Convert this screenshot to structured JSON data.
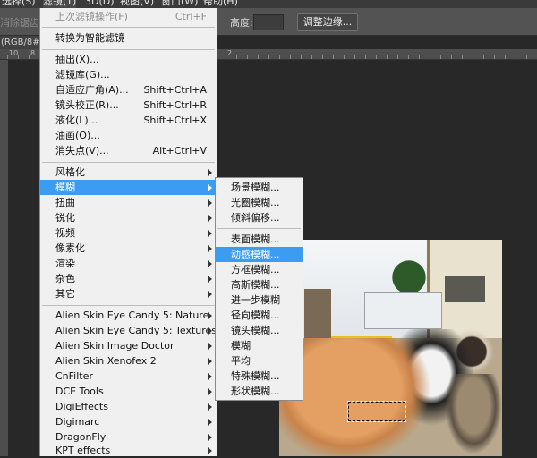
{
  "menubar": {
    "items": [
      {
        "label": "选择(S)",
        "active": false
      },
      {
        "label": "滤镜(T)",
        "active": true
      },
      {
        "label": "3D(D)",
        "active": false
      },
      {
        "label": "视图(V)",
        "active": false
      },
      {
        "label": "窗口(W)",
        "active": false
      },
      {
        "label": "帮助(H)",
        "active": false
      }
    ]
  },
  "options_bar": {
    "ghost_text": "消除锯齿",
    "height_label": "高度:",
    "refine_edge_button": "调整边缘..."
  },
  "document": {
    "tab_label": "(RGB/8#)",
    "ruler_numbers": [
      "10",
      "8",
      "2"
    ]
  },
  "filter_menu": {
    "items": [
      {
        "label": "上次滤镜操作(F)",
        "shortcut": "Ctrl+F",
        "disabled": true
      },
      {
        "label": "转换为智能滤镜"
      },
      {
        "label": "抽出(X)..."
      },
      {
        "label": "滤镜库(G)..."
      },
      {
        "label": "自适应广角(A)...",
        "shortcut": "Shift+Ctrl+A"
      },
      {
        "label": "镜头校正(R)...",
        "shortcut": "Shift+Ctrl+R"
      },
      {
        "label": "液化(L)...",
        "shortcut": "Shift+Ctrl+X"
      },
      {
        "label": "油画(O)..."
      },
      {
        "label": "消失点(V)...",
        "shortcut": "Alt+Ctrl+V"
      },
      {
        "label": "风格化",
        "submenu": true
      },
      {
        "label": "模糊",
        "submenu": true,
        "highlighted": true
      },
      {
        "label": "扭曲",
        "submenu": true
      },
      {
        "label": "锐化",
        "submenu": true
      },
      {
        "label": "视频",
        "submenu": true
      },
      {
        "label": "像素化",
        "submenu": true
      },
      {
        "label": "渲染",
        "submenu": true
      },
      {
        "label": "杂色",
        "submenu": true
      },
      {
        "label": "其它",
        "submenu": true
      },
      {
        "label": "Alien Skin Eye Candy 5: Nature",
        "submenu": true
      },
      {
        "label": "Alien Skin Eye Candy 5: Textures",
        "submenu": true
      },
      {
        "label": "Alien Skin Image Doctor",
        "submenu": true
      },
      {
        "label": "Alien Skin Xenofex 2",
        "submenu": true
      },
      {
        "label": "CnFilter",
        "submenu": true
      },
      {
        "label": "DCE Tools",
        "submenu": true
      },
      {
        "label": "DigiEffects",
        "submenu": true
      },
      {
        "label": "Digimarc",
        "submenu": true
      },
      {
        "label": "DragonFly",
        "submenu": true
      },
      {
        "label": "KPT effects",
        "submenu": true
      }
    ]
  },
  "blur_submenu": {
    "items": [
      {
        "label": "场景模糊..."
      },
      {
        "label": "光圈模糊..."
      },
      {
        "label": "倾斜偏移..."
      },
      {
        "label": "表面模糊..."
      },
      {
        "label": "动感模糊...",
        "highlighted": true
      },
      {
        "label": "方框模糊..."
      },
      {
        "label": "高斯模糊..."
      },
      {
        "label": "进一步模糊"
      },
      {
        "label": "径向模糊..."
      },
      {
        "label": "镜头模糊..."
      },
      {
        "label": "模糊"
      },
      {
        "label": "平均"
      },
      {
        "label": "特殊模糊..."
      },
      {
        "label": "形状模糊..."
      }
    ]
  },
  "colors": {
    "highlight": "#3b9cf2",
    "menu_bg": "#f0f0f0",
    "app_bg": "#282828"
  }
}
